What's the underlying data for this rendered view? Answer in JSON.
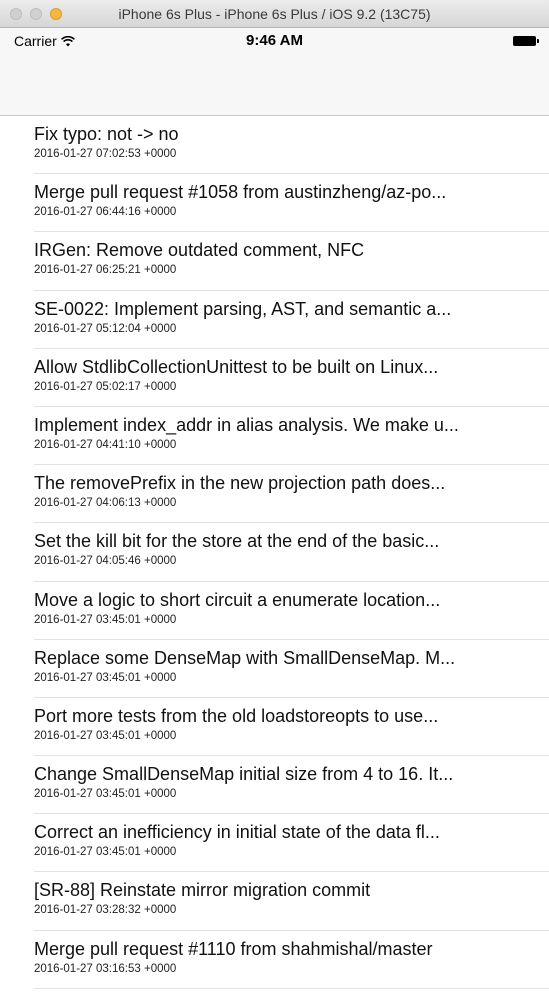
{
  "window": {
    "title": "iPhone 6s Plus - iPhone 6s Plus / iOS 9.2 (13C75)"
  },
  "status_bar": {
    "carrier": "Carrier",
    "time": "9:46 AM",
    "wifi_icon": "wifi-icon",
    "battery_icon": "battery-icon"
  },
  "colors": {
    "zoom_button": "#f5b83c",
    "separator": "#e2e2e4",
    "navbar": "#f7f7f7"
  },
  "commits": [
    {
      "message": "Fix typo: not -> no",
      "date": "2016-01-27 07:02:53 +0000"
    },
    {
      "message": "Merge pull request #1058 from austinzheng/az-po...",
      "date": "2016-01-27 06:44:16 +0000"
    },
    {
      "message": "IRGen: Remove outdated comment, NFC",
      "date": "2016-01-27 06:25:21 +0000"
    },
    {
      "message": "SE-0022: Implement parsing, AST, and semantic a...",
      "date": "2016-01-27 05:12:04 +0000"
    },
    {
      "message": "Allow StdlibCollectionUnittest to be built on Linux...",
      "date": "2016-01-27 05:02:17 +0000"
    },
    {
      "message": "Implement index_addr in alias analysis. We make u...",
      "date": "2016-01-27 04:41:10 +0000"
    },
    {
      "message": "The removePrefix in the new projection path does...",
      "date": "2016-01-27 04:06:13 +0000"
    },
    {
      "message": "Set the kill bit for the store at the end of the basic...",
      "date": "2016-01-27 04:05:46 +0000"
    },
    {
      "message": "Move a logic to short circuit a enumerate location...",
      "date": "2016-01-27 03:45:01 +0000"
    },
    {
      "message": "Replace some DenseMap with SmallDenseMap. M...",
      "date": "2016-01-27 03:45:01 +0000"
    },
    {
      "message": "Port more tests from the old loadstoreopts to use...",
      "date": "2016-01-27 03:45:01 +0000"
    },
    {
      "message": "Change SmallDenseMap initial size from 4 to 16. It...",
      "date": "2016-01-27 03:45:01 +0000"
    },
    {
      "message": "Correct an inefficiency in initial state of the data fl...",
      "date": "2016-01-27 03:45:01 +0000"
    },
    {
      "message": "[SR-88] Reinstate mirror migration commit",
      "date": "2016-01-27 03:28:32 +0000"
    },
    {
      "message": "Merge pull request #1110 from shahmishal/master",
      "date": "2016-01-27 03:16:53 +0000"
    }
  ]
}
